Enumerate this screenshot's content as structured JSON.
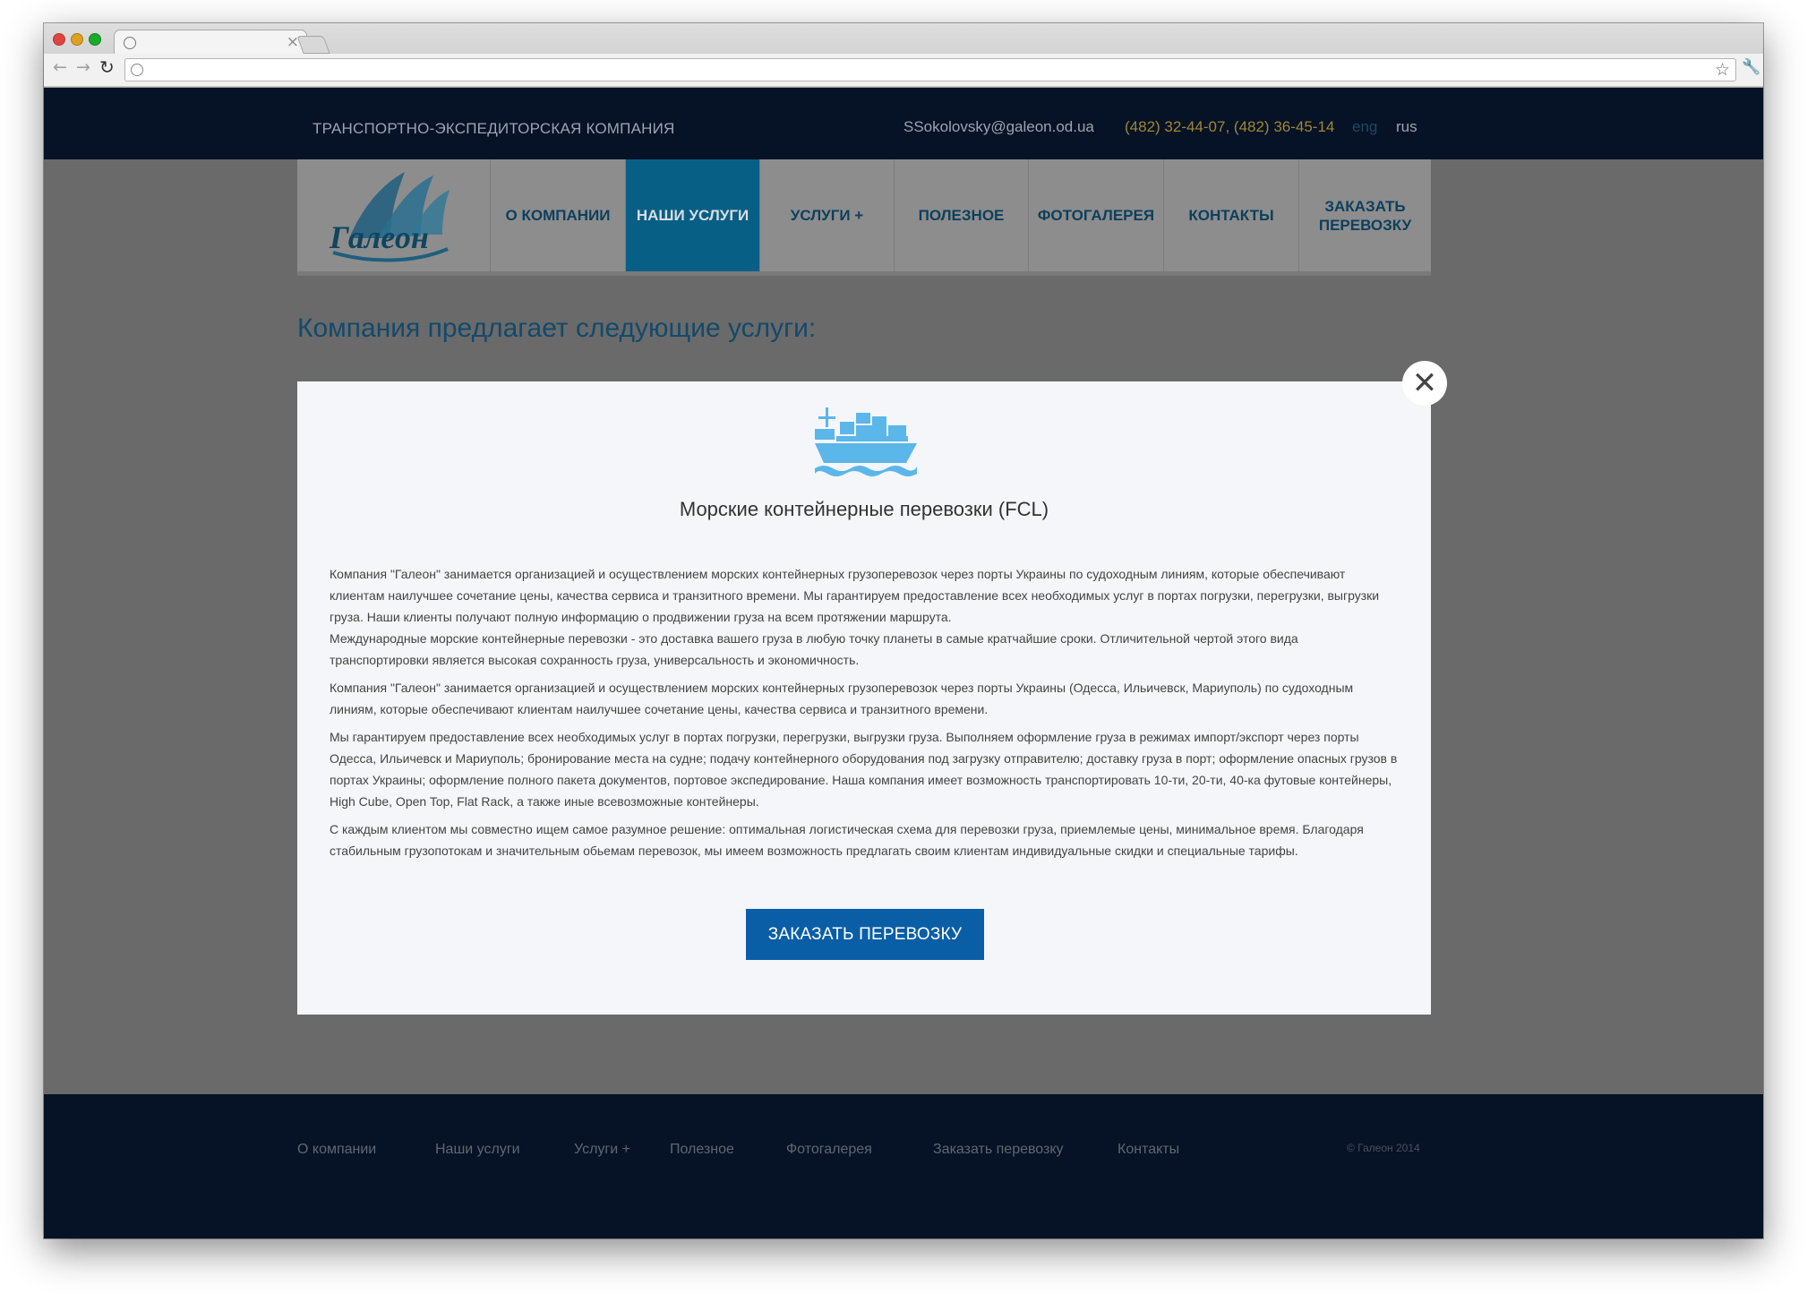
{
  "header": {
    "tagline": "ТРАНСПОРТНО-ЭКСПЕДИТОРСКАЯ КОМПАНИЯ",
    "email": "SSokolovsky@galeon.od.ua",
    "phones": "(482) 32-44-07, (482) 36-45-14",
    "lang_eng": "eng",
    "lang_rus": "rus"
  },
  "logo": {
    "text": "Галеон"
  },
  "nav": {
    "about": "О КОМПАНИИ",
    "services": "НАШИ УСЛУГИ",
    "services_plus": "УСЛУГИ +",
    "useful": "ПОЛЕЗНОЕ",
    "gallery": "ФОТОГАЛЕРЕЯ",
    "contacts": "КОНТАКТЫ",
    "order": "ЗАКАЗАТЬ ПЕРЕВОЗКУ"
  },
  "page_heading": "Компания предлагает следующие услуги:",
  "modal": {
    "icon": "ship-icon",
    "title": "Морские контейнерные перевозки (FCL)",
    "paragraphs": [
      "Компания \"Галеон\" занимается организацией и осуществлением морских контейнерных грузоперевозок через порты Украины по судоходным линиям, которые обеспечивают клиентам наилучшее сочетание цены, качества сервиса и транзитного времени. Мы гарантируем предоставление всех необходимых услуг в портах погрузки, перегрузки, выгрузки груза. Наши клиенты получают полную информацию о продвижении груза на всем протяжении маршрута.",
      "Международные морские контейнерные перевозки - это доставка вашего груза в любую точку планеты в самые кратчайшие сроки. Отличительной чертой этого вида транспортировки является высокая сохранность груза, универсальность и экономичность.",
      "Компания \"Галеон\" занимается организацией и осуществлением морских контейнерных грузоперевозок через порты Украины (Одесса, Ильичевск, Мариуполь) по судоходным линиям, которые обеспечивают клиентам наилучшее сочетание цены, качества сервиса и транзитного времени.",
      "Мы гарантируем предоставление всех необходимых услуг в портах погрузки, перегрузки, выгрузки груза. Выполняем оформление груза в режимах импорт/экспорт через порты Одесса, Ильичевск и Мариуполь; бронирование места на судне; подачу контейнерного оборудования под загрузку отправителю; доставку груза в порт; оформление опасных грузов в портах Украины; оформление полного пакета документов, портовое экспедирование. Наша компания имеет возможность транспортировать 10-ти, 20-ти, 40-ка футовые контейнеры, High Cube, Open Top, Flat Rack, а также иные всевозможные контейнеры.",
      "С каждым клиентом мы совместно ищем самое разумное решение: оптимальная логистическая схема для перевозки груза, приемлемые цены, минимальное время. Благодаря стабильным грузопотокам и значительным обьемам перевозок, мы имеем возможность предлагать своим клиентам индивидуальные скидки и специальные тарифы."
    ],
    "button": "ЗАКАЗАТЬ ПЕРЕВОЗКУ",
    "close_icon": "close-icon"
  },
  "footer": {
    "links": [
      "О компании",
      "Наши услуги",
      "Услуги +",
      "Полезное",
      "Фотогалерея",
      "Заказать перевозку",
      "Контакты"
    ],
    "copyright": "© Галеон 2014"
  },
  "colors": {
    "topbar": "#061226",
    "nav_active": "#085f85",
    "heading": "#13496b",
    "button": "#0a5ea6",
    "phones": "#a08732"
  }
}
